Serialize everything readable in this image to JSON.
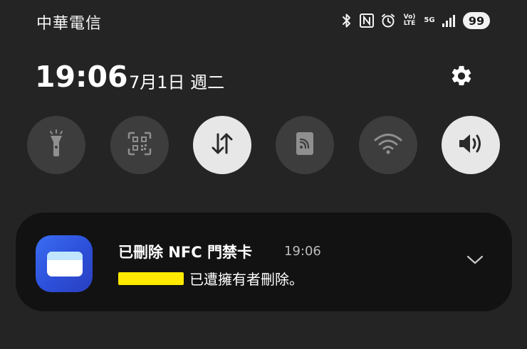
{
  "status_bar": {
    "carrier": "中華電信",
    "icons": [
      "bluetooth-icon",
      "nfc-icon",
      "alarm-icon",
      "volte-icon",
      "5g-icon",
      "signal-icon"
    ],
    "volte_label": "Vo) LTE",
    "network_label": "5G",
    "battery": "99"
  },
  "header": {
    "time": "19:06",
    "date": "7月1日 週二"
  },
  "quick_tiles": [
    {
      "name": "flashlight",
      "icon": "flashlight-icon",
      "active": false
    },
    {
      "name": "qr-scanner",
      "icon": "qr-scan-icon",
      "active": false
    },
    {
      "name": "mobile-data",
      "icon": "data-arrows-icon",
      "active": true
    },
    {
      "name": "nfc",
      "icon": "nfc-card-icon",
      "active": false
    },
    {
      "name": "wifi",
      "icon": "wifi-icon",
      "active": false
    },
    {
      "name": "sound",
      "icon": "speaker-icon",
      "active": true
    }
  ],
  "notification": {
    "title": "已刪除 NFC 門禁卡",
    "time": "19:06",
    "body": "已遭擁有者刪除。",
    "app_icon": "wallet-card-icon"
  },
  "colors": {
    "background": "#242424",
    "tile_off": "#3d3d3d",
    "tile_on": "#e7e7e7",
    "card": "#121212",
    "app_icon": "#2c4fd9",
    "redaction": "#ffe900"
  }
}
